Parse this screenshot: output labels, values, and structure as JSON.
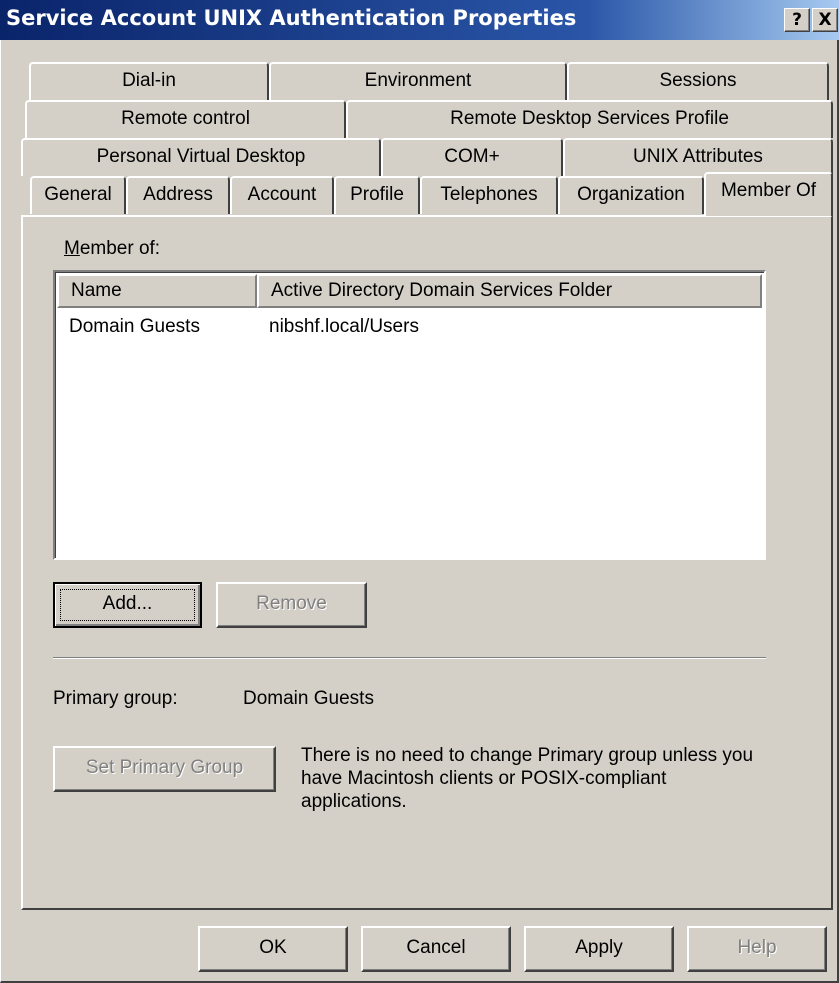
{
  "window": {
    "title": "Service Account UNIX Authentication Properties",
    "help_button": "?",
    "close_button": "X"
  },
  "tabs": {
    "row1": [
      "Dial-in",
      "Environment",
      "Sessions"
    ],
    "row2": [
      "Remote control",
      "Remote Desktop Services Profile"
    ],
    "row3": [
      "Personal Virtual Desktop",
      "COM+",
      "UNIX Attributes"
    ],
    "row4": [
      "General",
      "Address",
      "Account",
      "Profile",
      "Telephones",
      "Organization",
      "Member Of"
    ],
    "active": "Member Of"
  },
  "member_of": {
    "label": "Member of:",
    "columns": [
      "Name",
      "Active Directory Domain Services Folder"
    ],
    "rows": [
      {
        "name": "Domain Guests",
        "folder": "nibshf.local/Users"
      }
    ],
    "add_button": "Add...",
    "remove_button": "Remove"
  },
  "primary_group": {
    "label": "Primary group:",
    "value": "Domain Guests",
    "set_button": "Set Primary Group",
    "note": "There is no need to change Primary group unless you have Macintosh clients or POSIX-compliant applications."
  },
  "footer": {
    "ok": "OK",
    "cancel": "Cancel",
    "apply": "Apply",
    "help": "Help"
  }
}
